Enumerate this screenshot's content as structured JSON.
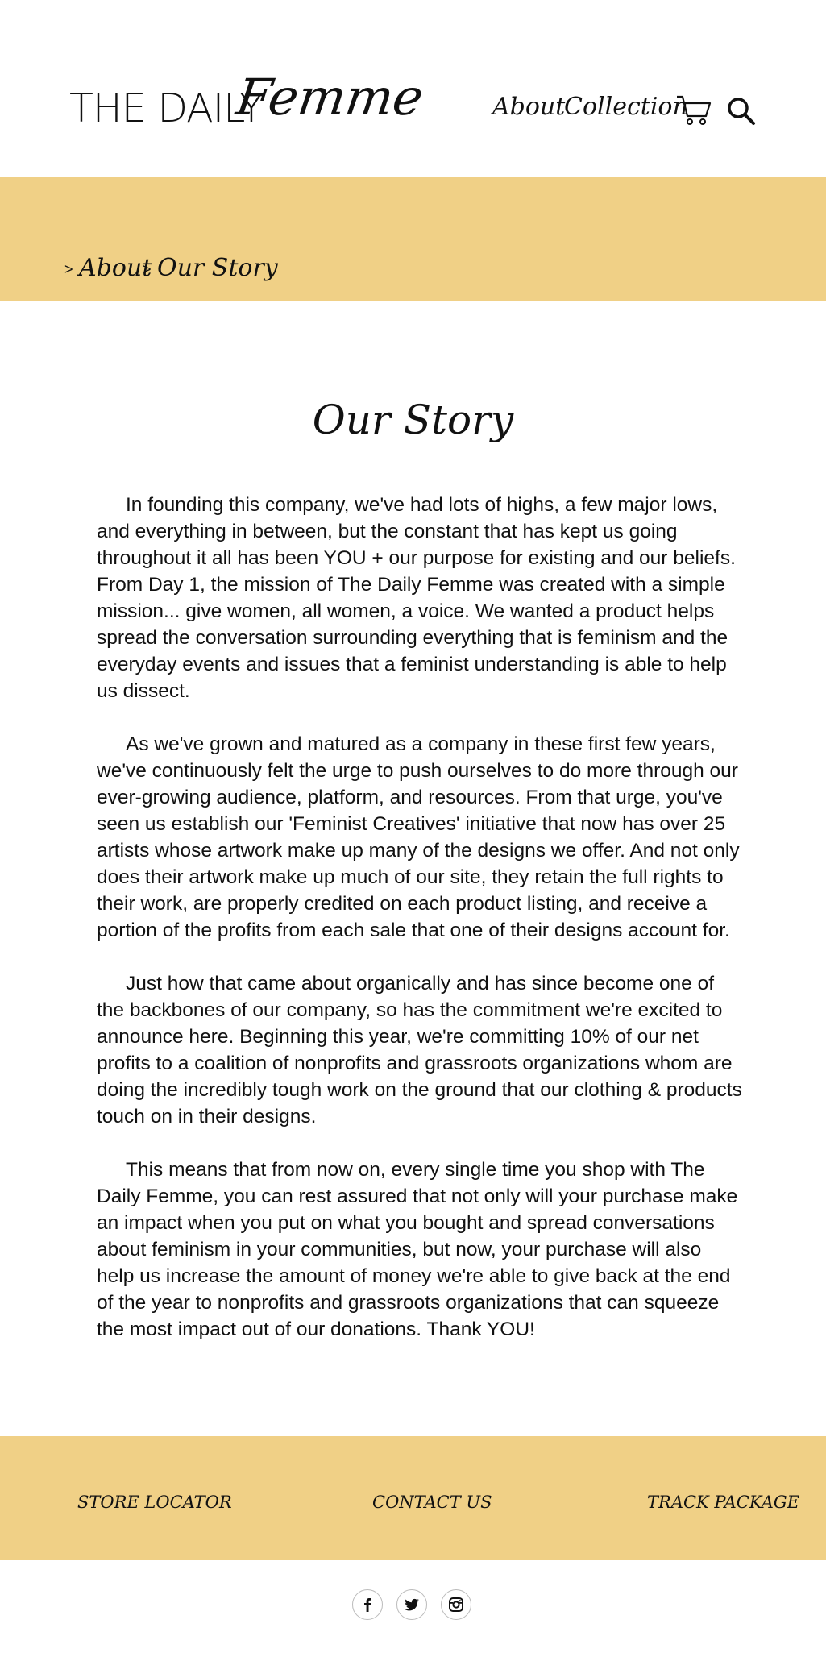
{
  "header": {
    "logo": {
      "plain": "THE DAILY",
      "script": "Femme"
    },
    "nav": {
      "about": "About",
      "collection": "Collection"
    },
    "icons": {
      "cart": "cart-icon",
      "search": "search-icon"
    }
  },
  "breadcrumb": {
    "items": [
      "About",
      "Our Story"
    ],
    "separator": ">"
  },
  "page_title": "Our Story",
  "story": {
    "paragraphs": [
      "In founding this company, we've had lots of highs, a few major lows, and everything in between, but the constant that has kept us going throughout it all has been YOU + our purpose for existing and our beliefs. From Day 1, the mission of The Daily Femme was created with a simple mission... give women, all women, a voice. We wanted a product helps spread the conversation surrounding everything that is feminism and the everyday events and issues that a feminist understanding is able to help us dissect.",
      "As we've grown and matured as a company in these first few years, we've continuously felt the urge to push ourselves to do more through our ever-growing audience, platform, and resources. From that urge, you've seen us establish our 'Feminist Creatives' initiative that now has over 25 artists whose artwork make up many of the designs we offer. And not only does their artwork make up much of our site, they retain the full rights to their work, are properly credited on each product listing, and receive a portion of the profits from each sale that one of their designs account for.",
      "Just how that came about organically and has since become one of the backbones of our company, so has the commitment we're excited to announce here. Beginning this year, we're committing 10% of our net profits to a coalition of nonprofits and grassroots organizations whom are doing the incredibly tough work on the ground that our clothing & products touch on in their designs.",
      "This means that from now on, every single time you shop with The Daily Femme, you can rest assured that not only will your purchase make an impact when you put on what you bought and spread conversations about feminism in your communities, but now, your purchase will also help us increase the amount of money we're able to give back at the end of the year to nonprofits and grassroots organizations that can squeeze the most impact out of our donations. Thank YOU!"
    ]
  },
  "footer": {
    "links": [
      "STORE LOCATOR",
      "CONTACT US",
      "TRACK PACKAGE"
    ],
    "socials": [
      "facebook-icon",
      "twitter-icon",
      "instagram-icon"
    ]
  },
  "colors": {
    "accent_band": "#f0d086",
    "text": "#111111",
    "background": "#ffffff"
  }
}
